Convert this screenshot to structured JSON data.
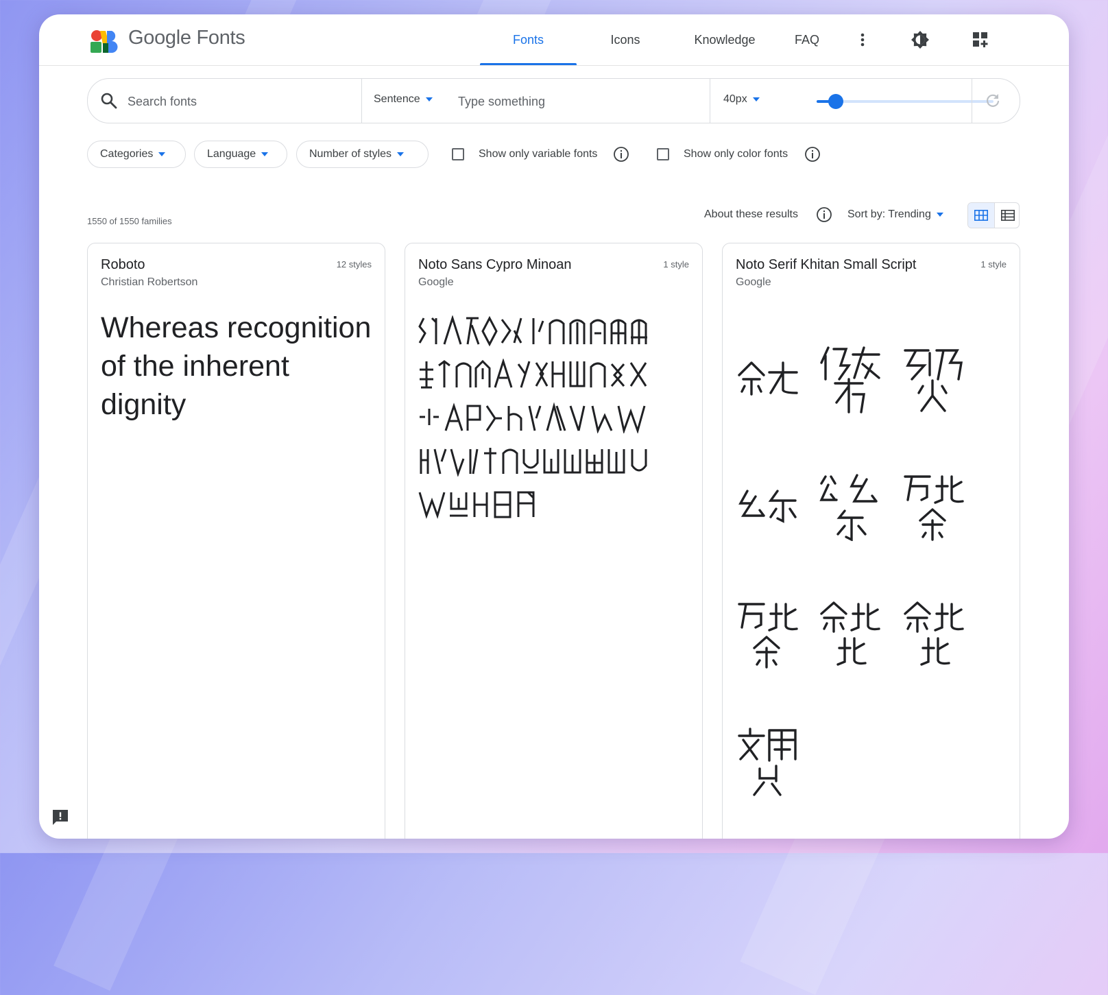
{
  "header": {
    "logo_text": "Google Fonts",
    "tabs": [
      {
        "label": "Fonts",
        "active": true
      },
      {
        "label": "Icons",
        "active": false
      },
      {
        "label": "Knowledge",
        "active": false
      },
      {
        "label": "FAQ",
        "active": false
      }
    ],
    "icons": [
      "more-vert-icon",
      "brightness-icon",
      "apps-add-icon"
    ]
  },
  "search": {
    "placeholder": "Search fonts",
    "preview_mode": "Sentence",
    "preview_placeholder": "Type something",
    "size_label": "40px",
    "size_slider_fraction": 0.11
  },
  "filters": {
    "chips": [
      "Categories",
      "Language",
      "Number of styles"
    ],
    "checkboxes": [
      {
        "label": "Show only variable fonts",
        "checked": false
      },
      {
        "label": "Show only color fonts",
        "checked": false
      }
    ]
  },
  "results": {
    "count_text": "1550 of 1550 families",
    "about_label": "About these results",
    "sort_label": "Sort by: Trending",
    "view_mode": "grid"
  },
  "cards": [
    {
      "name": "Roboto",
      "author": "Christian Robertson",
      "styles": "12 styles",
      "preview": "Whereas recognition of the inherent dignity"
    },
    {
      "name": "Noto Sans Cypro Minoan",
      "author": "Google",
      "styles": "1 style"
    },
    {
      "name": "Noto Serif Khitan Small Script",
      "author": "Google",
      "styles": "1 style"
    }
  ],
  "colors": {
    "accent": "#1a73e8",
    "text": "#3c4043",
    "muted": "#5f6368",
    "border": "#dadce0"
  }
}
